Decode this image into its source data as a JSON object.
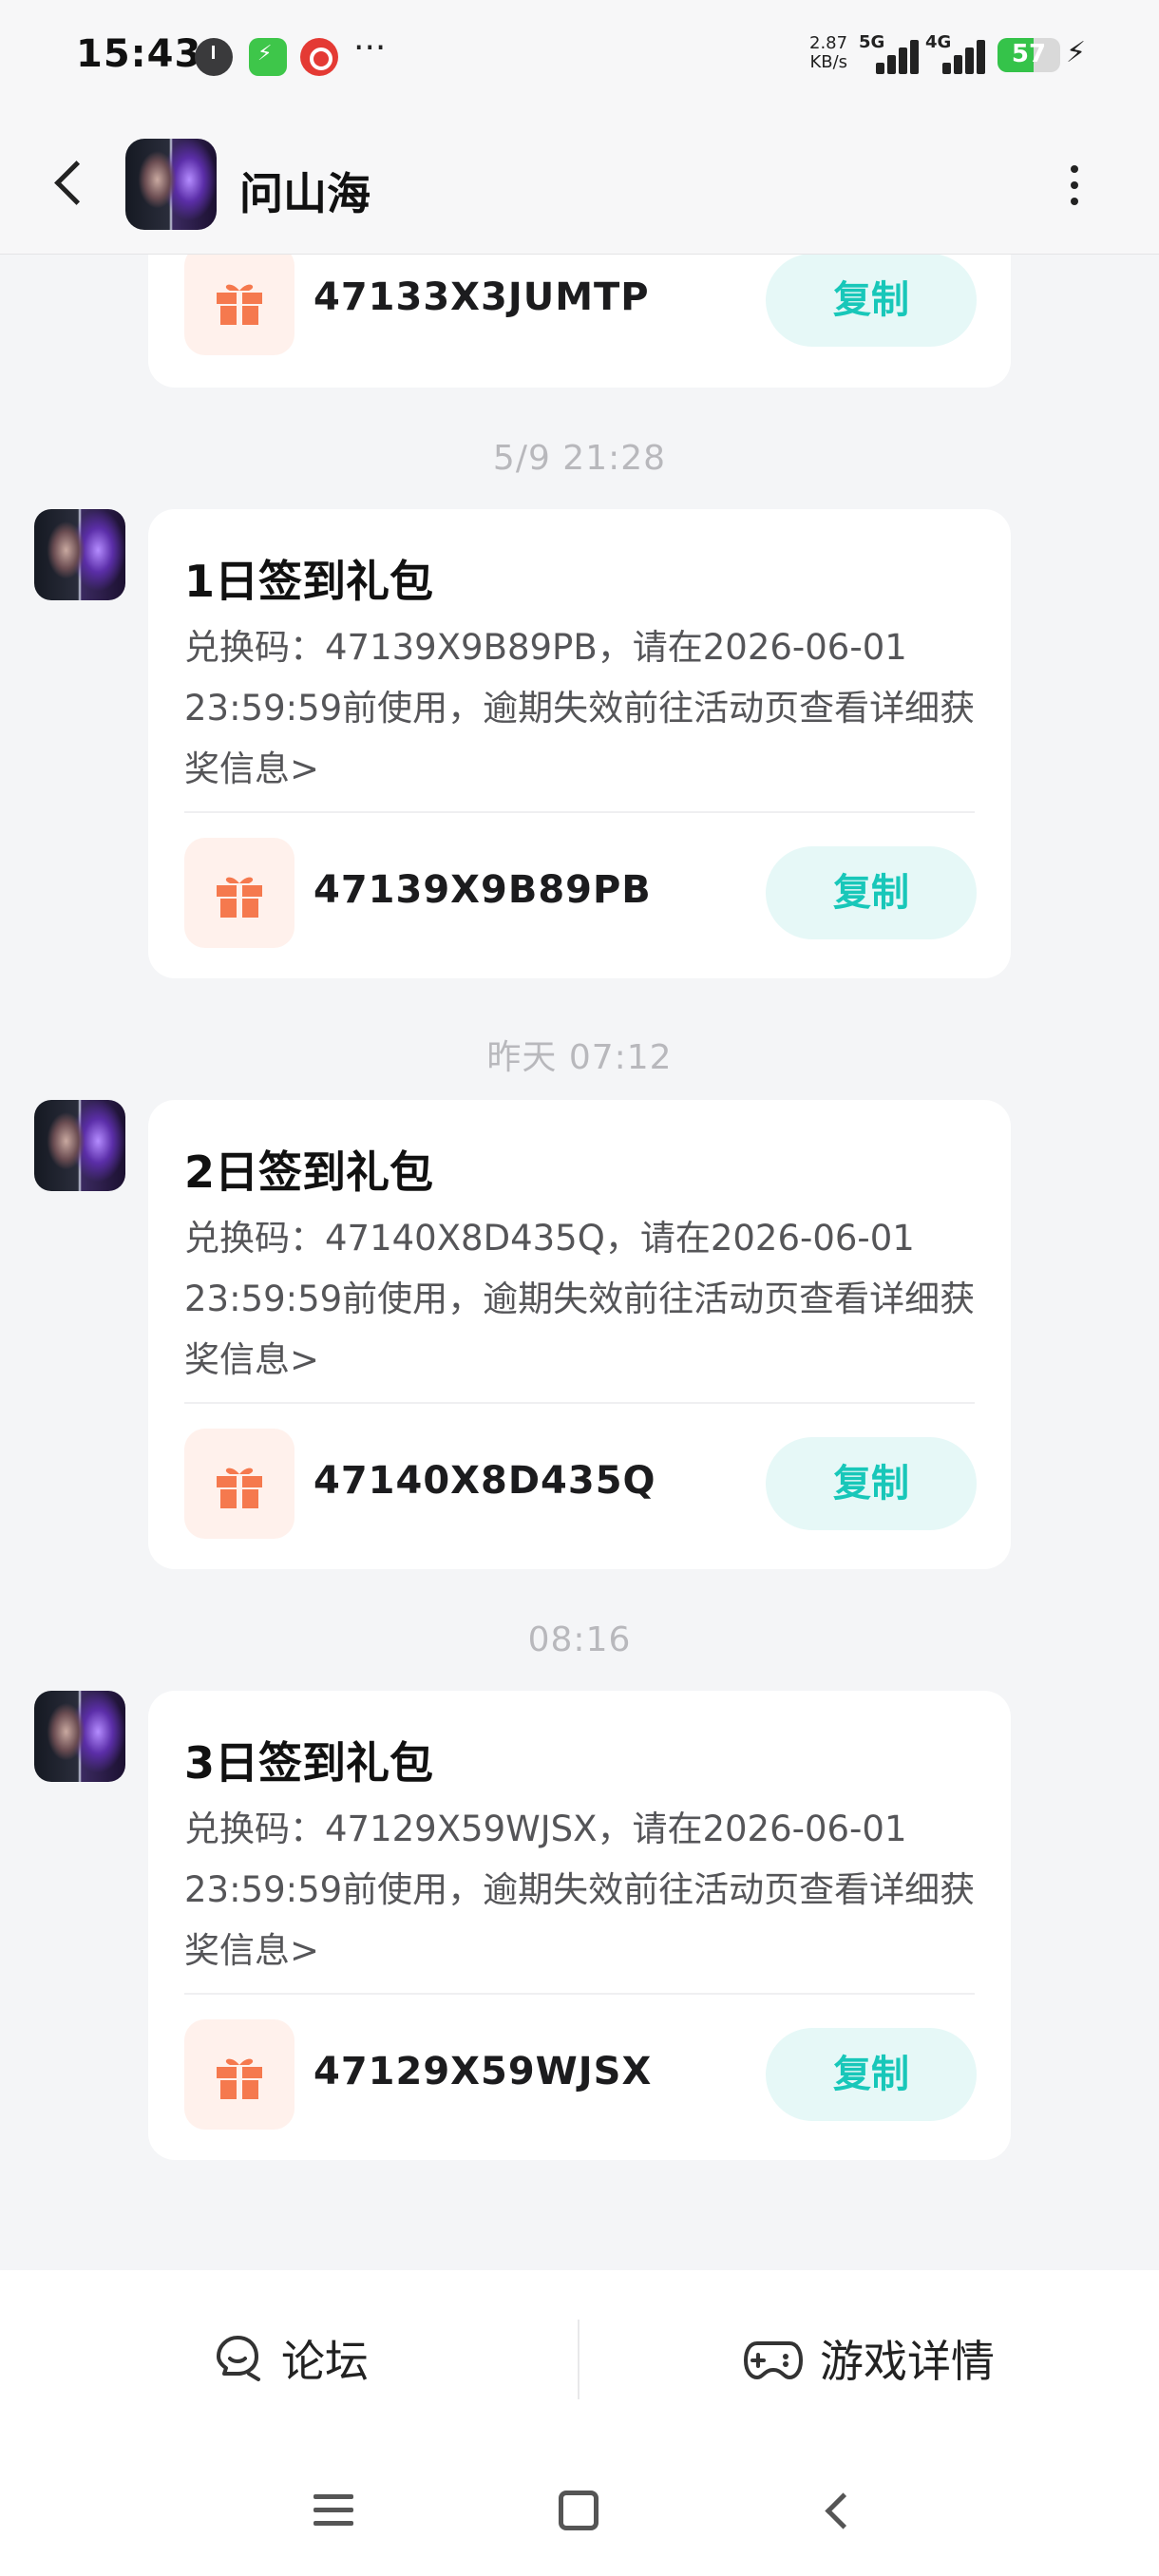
{
  "status_bar": {
    "time": "15:43",
    "net_speed_value": "2.87",
    "net_speed_unit": "KB/s",
    "signal_1_label": "5G",
    "signal_2_label": "4G",
    "battery_level": "57"
  },
  "header": {
    "title": "问山海"
  },
  "messages": [
    {
      "code": "47133X3JUMTP",
      "copy_label": "复制"
    },
    {
      "timestamp": "5/9  21:28",
      "title": "1日签到礼包",
      "body": "兑换码：47139X9B89PB，请在2026-06-01 23:59:59前使用，逾期失效前往活动页查看详细获奖信息>",
      "code": "47139X9B89PB",
      "copy_label": "复制"
    },
    {
      "timestamp": "昨天  07:12",
      "title": "2日签到礼包",
      "body": "兑换码：47140X8D435Q，请在2026-06-01 23:59:59前使用，逾期失效前往活动页查看详细获奖信息>",
      "code": "47140X8D435Q",
      "copy_label": "复制"
    },
    {
      "timestamp": "08:16",
      "title": "3日签到礼包",
      "body": "兑换码：47129X59WJSX，请在2026-06-01 23:59:59前使用，逾期失效前往活动页查看详细获奖信息>",
      "code": "47129X59WJSX",
      "copy_label": "复制"
    }
  ],
  "bottom_bar": {
    "forum_label": "论坛",
    "detail_label": "游戏详情"
  },
  "colors": {
    "accent": "#18c7b9",
    "copy_bg": "#e6f8f7",
    "gift": "#f5794e",
    "gift_bg": "#fff1ec"
  }
}
